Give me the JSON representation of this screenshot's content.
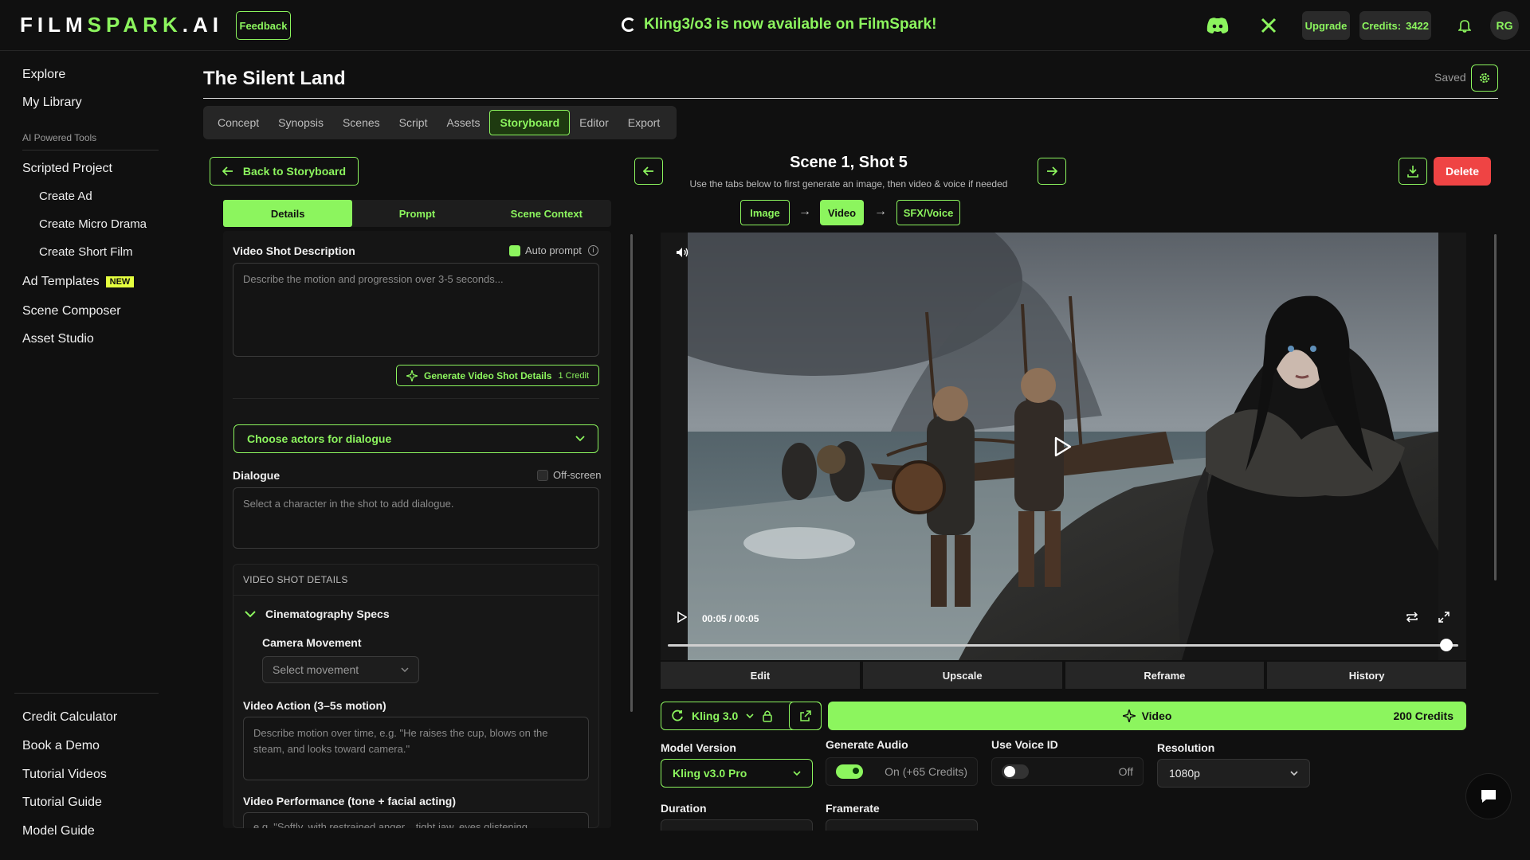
{
  "brand": {
    "logo_prefix": "FILM",
    "logo_spark": "SPARK",
    "logo_suffix": ".AI",
    "accent": "#8cf55e",
    "danger": "#ef4444"
  },
  "topbar": {
    "feedback_label": "Feedback",
    "announcement": "Kling3/o3 is now available on FilmSpark!",
    "upgrade_label": "Upgrade",
    "credits_label": "Credits:",
    "credits_value": "3422",
    "avatar_initials": "RG",
    "icons": [
      "discord-icon",
      "x-icon",
      "bell-icon"
    ]
  },
  "sidebar": {
    "top_items": [
      "Explore",
      "My Library"
    ],
    "section_label": "AI Powered Tools",
    "scripted_project": "Scripted Project",
    "sub_items": [
      "Create Ad",
      "Create Micro Drama",
      "Create Short Film"
    ],
    "ad_templates": "Ad Templates",
    "new_badge": "NEW",
    "more_items": [
      "Scene Composer",
      "Asset Studio"
    ],
    "bottom_items": [
      "Credit Calculator",
      "Book a Demo",
      "Tutorial Videos",
      "Tutorial Guide",
      "Model Guide"
    ]
  },
  "project": {
    "title": "The Silent Land",
    "saved_label": "Saved"
  },
  "tabs": [
    "Concept",
    "Synopsis",
    "Scenes",
    "Script",
    "Assets",
    "Storyboard",
    "Editor",
    "Export"
  ],
  "active_tab": "Storyboard",
  "left": {
    "back_label": "Back to Storyboard",
    "subtabs": [
      "Details",
      "Prompt",
      "Scene Context"
    ],
    "video_shot_description_label": "Video Shot Description",
    "auto_prompt_label": "Auto prompt",
    "description_placeholder": "Describe the motion and progression over 3-5 seconds...",
    "generate_details_label": "Generate Video Shot Details",
    "generate_details_cost": "1 Credit",
    "actors_label": "Choose actors for dialogue",
    "dialogue_label": "Dialogue",
    "offscreen_label": "Off-screen",
    "dialogue_placeholder": "Select a character in the shot to add dialogue.",
    "section_heading": "VIDEO SHOT DETAILS",
    "cinematography_label": "Cinematography Specs",
    "camera_movement_label": "Camera Movement",
    "camera_movement_placeholder": "Select movement",
    "video_action_label": "Video Action (3–5s motion)",
    "video_action_placeholder": "Describe motion over time, e.g. \"He raises the cup, blows on the steam, and looks toward camera.\"",
    "video_performance_label": "Video Performance (tone + facial acting)",
    "video_performance_placeholder": "e.g. \"Softly, with restrained anger... tight jaw, eyes glistening..."
  },
  "shot": {
    "title": "Scene 1, Shot 5",
    "subtitle": "Use the tabs below to first generate an image, then video & voice if needed",
    "delete_label": "Delete",
    "steps": [
      "Image",
      "Video",
      "SFX/Voice"
    ],
    "active_step": "Video"
  },
  "player": {
    "time": "00:05 / 00:05",
    "progress": 1.0,
    "tools": [
      "Edit",
      "Upscale",
      "Reframe",
      "History"
    ]
  },
  "generation": {
    "model_label": "Kling 3.0",
    "video_button_label": "Video",
    "video_button_cost": "200 Credits",
    "model_version_label": "Model Version",
    "model_version_value": "Kling v3.0 Pro",
    "generate_audio_label": "Generate Audio",
    "generate_audio_state": "On (+65 Credits)",
    "use_voice_id_label": "Use Voice ID",
    "use_voice_id_state": "Off",
    "resolution_label": "Resolution",
    "resolution_value": "1080p",
    "duration_label": "Duration",
    "framerate_label": "Framerate"
  }
}
